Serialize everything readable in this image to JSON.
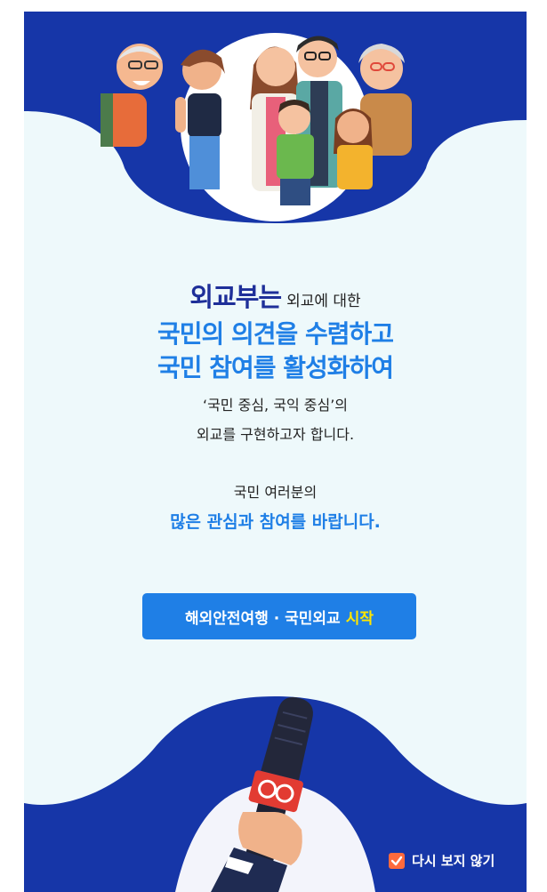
{
  "intro": {
    "title_lead": "외교부는",
    "title_rest": "외교에 대한",
    "headline_1": "국민의 의견을 수렴하고",
    "headline_2": "국민 참여를 활성화하여",
    "body_1": "‘국민 중심, 국익 중심’의",
    "body_2": "외교를 구현하고자 합니다.",
    "body_3": "국민 여러분의",
    "highlight": "많은 관심과 참여를 바랍니다."
  },
  "start_button": {
    "label": "해외안전여행 · 국민외교",
    "accent": "시작"
  },
  "dont_show": {
    "label": "다시 보지 않기",
    "checked": true
  },
  "colors": {
    "navy": "#1636a8",
    "accent_blue": "#1f7fe6",
    "background": "#eef9fb",
    "highlight_yellow": "#ffe600",
    "checkbox_orange": "#ff6a3d"
  },
  "icons": [
    "family-illustration",
    "microphone-illustration",
    "check-icon"
  ]
}
